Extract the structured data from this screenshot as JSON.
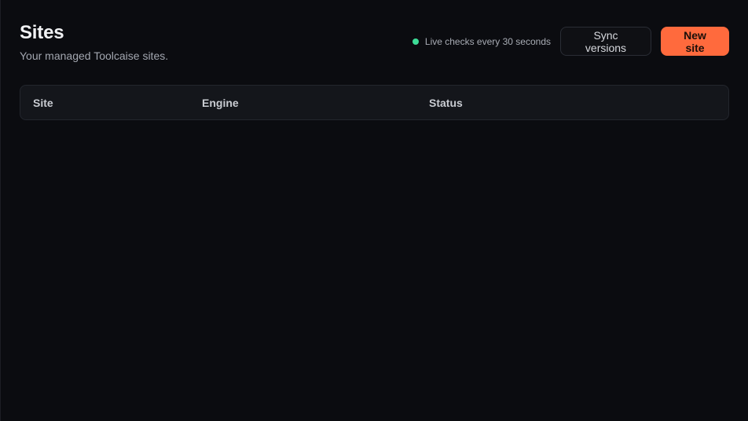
{
  "header": {
    "title": "Sites",
    "subtitle": "Your managed Toolcaise sites."
  },
  "live": {
    "text": "Live checks every 30 seconds",
    "dot_color": "#3ddc97"
  },
  "actions": {
    "sync_label": "Sync versions",
    "new_label": "New site",
    "primary_color": "#ff6a3d"
  },
  "table": {
    "columns": [
      "Site",
      "Engine",
      "Status"
    ]
  }
}
